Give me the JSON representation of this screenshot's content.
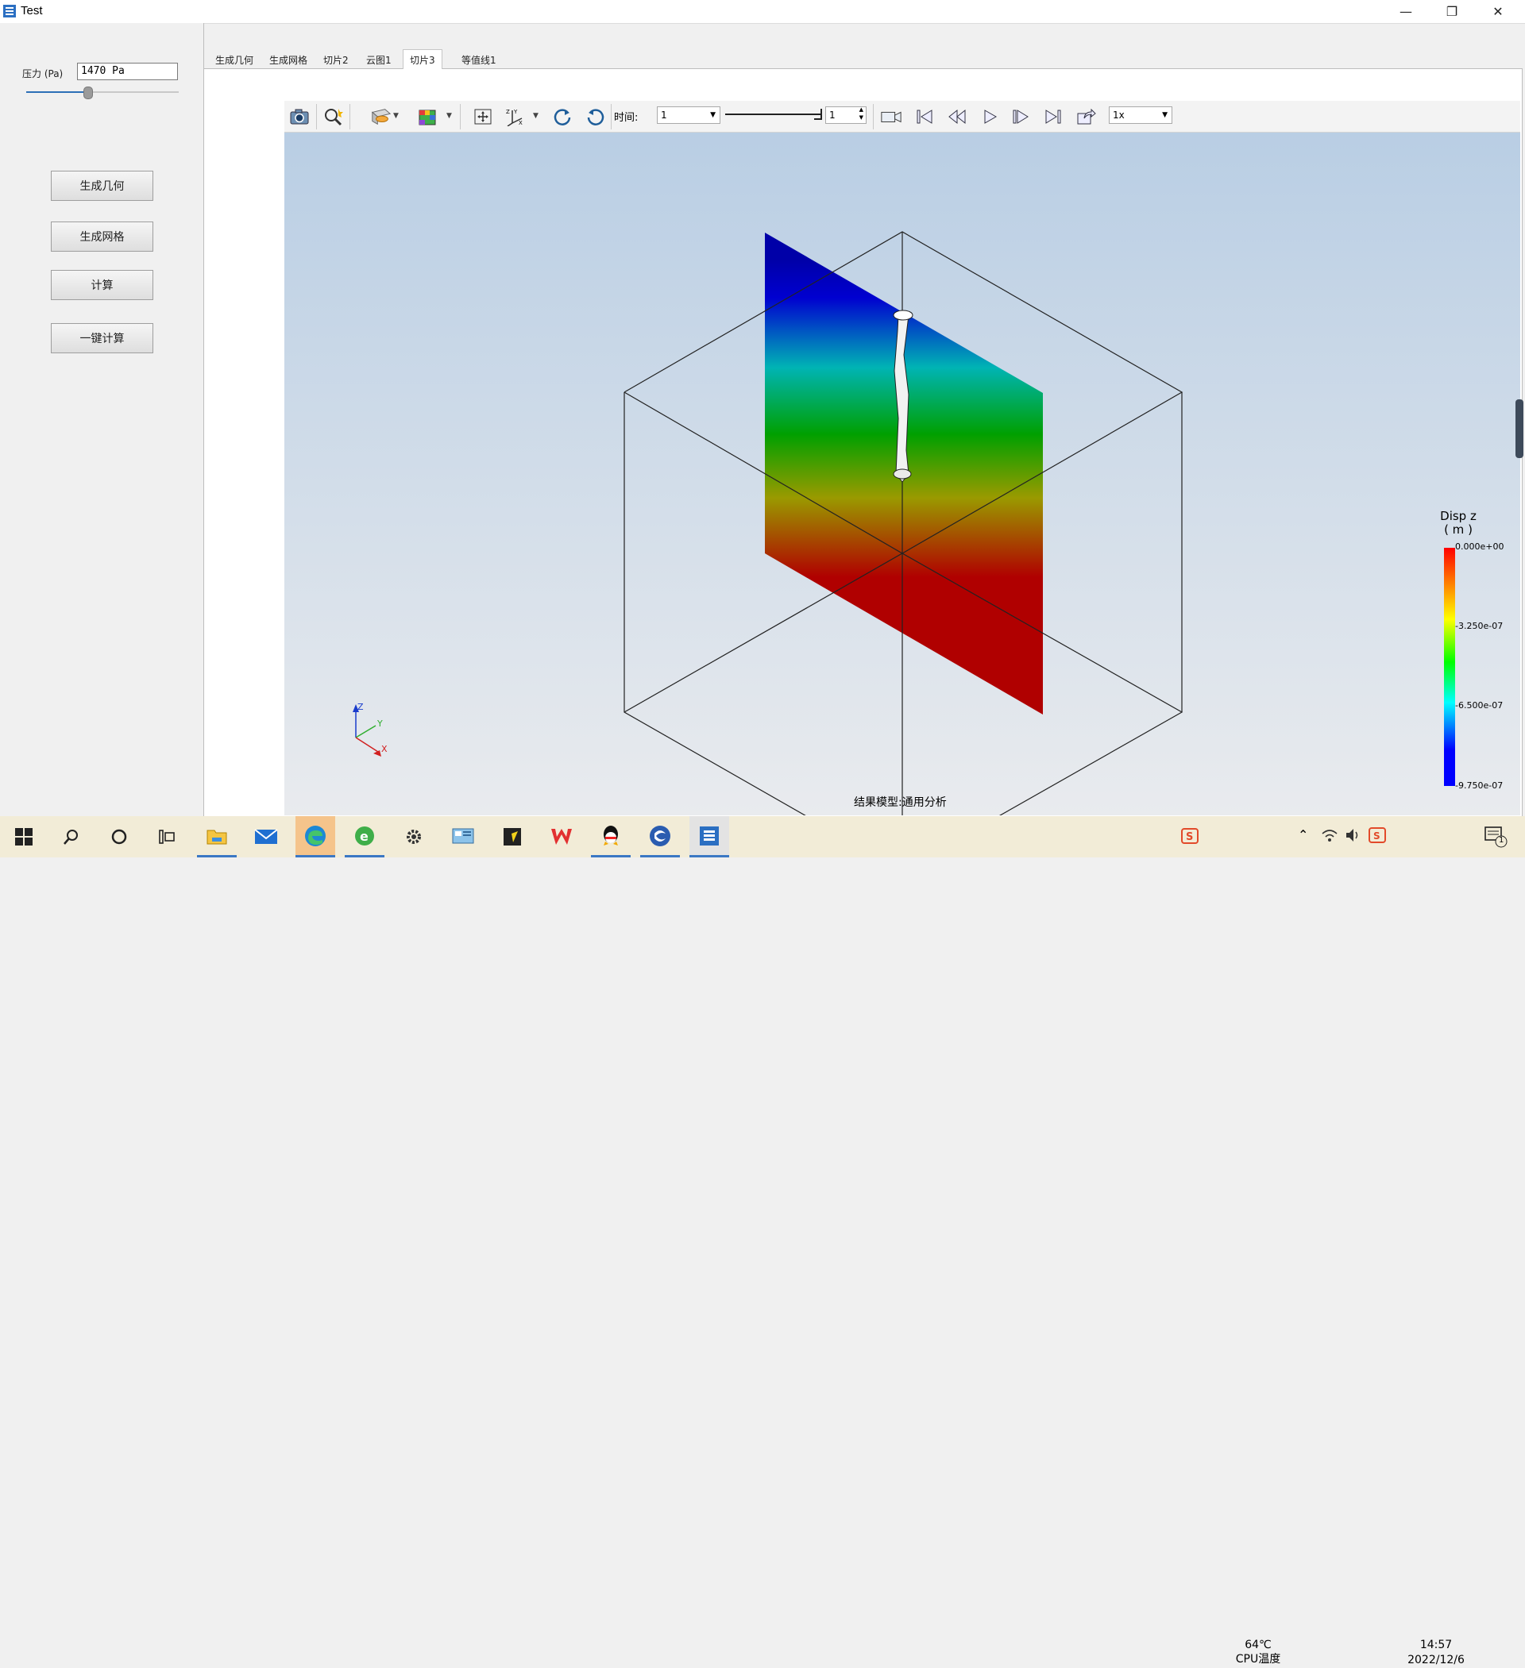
{
  "window": {
    "title": "Test",
    "minimize": "—",
    "restore": "❐",
    "close": "✕"
  },
  "left_panel": {
    "pressure_label": "压力 (Pa)",
    "pressure_value": "1470 Pa",
    "slider_value": 0.4,
    "buttons": [
      "生成几何",
      "生成网格",
      "计算",
      "一键计算"
    ]
  },
  "tabs": [
    {
      "label": "生成几何",
      "active": false
    },
    {
      "label": "生成网格",
      "active": false
    },
    {
      "label": "切片2",
      "active": false
    },
    {
      "label": "云图1",
      "active": false
    },
    {
      "label": "切片3",
      "active": true
    },
    {
      "label": "等值线1",
      "active": false
    }
  ],
  "toolbar": {
    "time_label": "时间:",
    "time_value": "1",
    "step_value": "1",
    "speed_value": "1x"
  },
  "viewport": {
    "model_label": "结果模型:通用分析",
    "axes": {
      "z": "Z",
      "y": "Y",
      "x": "X"
    }
  },
  "legend": {
    "title_line1": "Disp z",
    "title_line2": "( m )",
    "ticks": [
      "0.000e+00",
      "-3.250e-07",
      "-6.500e-07",
      "-9.750e-07"
    ]
  },
  "colors": {
    "accent": "#2d6fb7",
    "high": "#ff0000",
    "low": "#0000ff"
  },
  "taskbar": {
    "cpu_temp": "64℃",
    "cpu_label": "CPU温度",
    "time": "14:57",
    "date": "2022/12/6",
    "notification_count": "1"
  }
}
